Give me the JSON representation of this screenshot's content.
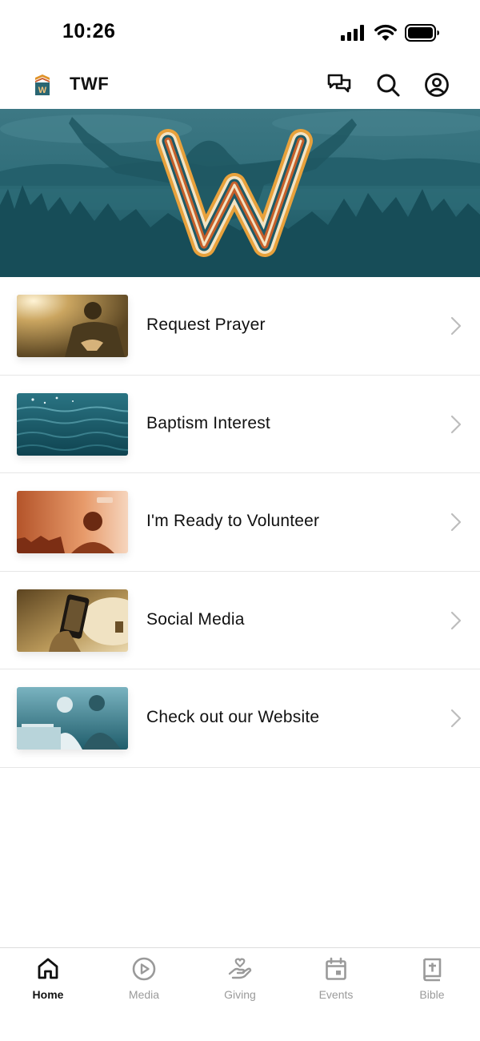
{
  "status_bar": {
    "time": "10:26"
  },
  "header": {
    "title": "TWF",
    "logo_letter": "W"
  },
  "banner": {
    "letter": "W"
  },
  "menu_items": [
    {
      "label": "Request Prayer"
    },
    {
      "label": "Baptism Interest"
    },
    {
      "label": "I'm Ready to Volunteer"
    },
    {
      "label": "Social Media"
    },
    {
      "label": "Check out our Website"
    }
  ],
  "tabs": [
    {
      "label": "Home",
      "icon": "home-icon",
      "active": true
    },
    {
      "label": "Media",
      "icon": "play-icon",
      "active": false
    },
    {
      "label": "Giving",
      "icon": "giving-hand-icon",
      "active": false
    },
    {
      "label": "Events",
      "icon": "calendar-icon",
      "active": false
    },
    {
      "label": "Bible",
      "icon": "bible-icon",
      "active": false
    }
  ],
  "colors": {
    "banner_teal": "#2a6673",
    "accent_orange": "#e0932a",
    "tab_inactive": "#9a9a9a"
  }
}
